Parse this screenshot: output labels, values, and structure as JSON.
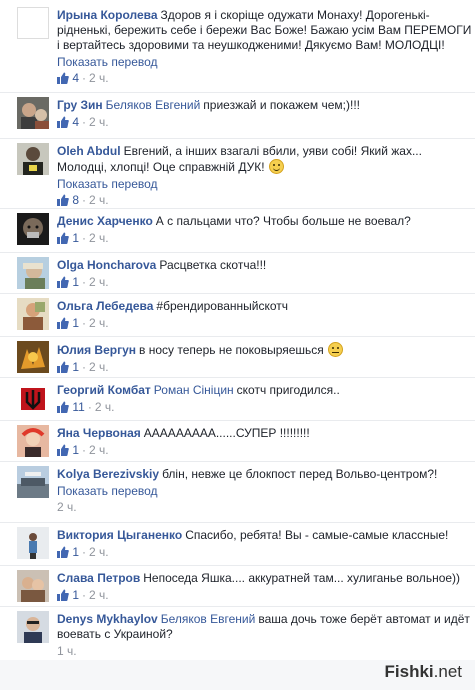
{
  "translate_label": "Показать перевод",
  "comments": [
    {
      "author": "Ирына Королева",
      "text": "Здоров я і скоріще одужати Монаху! Дорогенькі-рідненькі, бережить себе і бережи Вас Боже! Бажаю усім Вам ПЕРЕМОГИ і вертайтесь здоровими та неушкодженими! Дякуємо Вам! МОЛОДЦІ!",
      "likes": "4",
      "time": "2 ч.",
      "show_translate": true
    },
    {
      "author": "Гру Зин",
      "mention": "Беляков Евгений",
      "text": "приезжай и покажем чем;)!!!",
      "likes": "4",
      "time": "2 ч."
    },
    {
      "author": "Oleh Abdul",
      "text": "Евгений, а інших взагалі вбили, уяви собі! Який жах... Молодці, хлопці! Оце справжній ДУК!",
      "emoji": "wink",
      "likes": "8",
      "time": "2 ч.",
      "show_translate": true
    },
    {
      "author": "Денис Харченко",
      "text": "А с пальцами что? Чтобы больше не воевал?",
      "likes": "1",
      "time": "2 ч."
    },
    {
      "author": "Olga Honcharova",
      "text": "Расцветка скотча!!!",
      "likes": "1",
      "time": "2 ч."
    },
    {
      "author": "Ольга Лебедева",
      "text": "#брендированныйскотч",
      "likes": "1",
      "time": "2 ч."
    },
    {
      "author": "Юлия Вергун",
      "text": "в носу теперь не поковыряешься",
      "emoji": "sad",
      "likes": "1",
      "time": "2 ч."
    },
    {
      "author": "Георгий Комбат",
      "mention": "Роман Сініцин",
      "text": "скотч пригодился..",
      "likes": "11",
      "time": "2 ч."
    },
    {
      "author": "Яна Червоная",
      "text": "ААААААААА......СУПЕР !!!!!!!!!",
      "likes": "1",
      "time": "2 ч."
    },
    {
      "author": "Kolya Berezivskiy",
      "text": "блін, невже це блокпост перед Вольво-центром?!",
      "time": "2 ч.",
      "show_translate": true
    },
    {
      "author": "Виктория Цыганенко",
      "text": "Спасибо, ребята! Вы - самые-самые классные!",
      "likes": "1",
      "time": "2 ч."
    },
    {
      "author": "Слава Петров",
      "text": "Непоседа Яшка.... аккуратней там... хулиганье вольное))",
      "likes": "1",
      "time": "2 ч."
    },
    {
      "author": "Denys Mykhaylov",
      "mention": "Беляков Евгений",
      "text": "ваша дочь тоже берёт автомат и идёт воевать с Украиной?",
      "time": "1 ч."
    }
  ],
  "watermark": {
    "brand": "Fishki",
    "tld": ".net"
  },
  "colors": {
    "link": "#365899",
    "meta": "#90949c",
    "text": "#1d2129"
  }
}
